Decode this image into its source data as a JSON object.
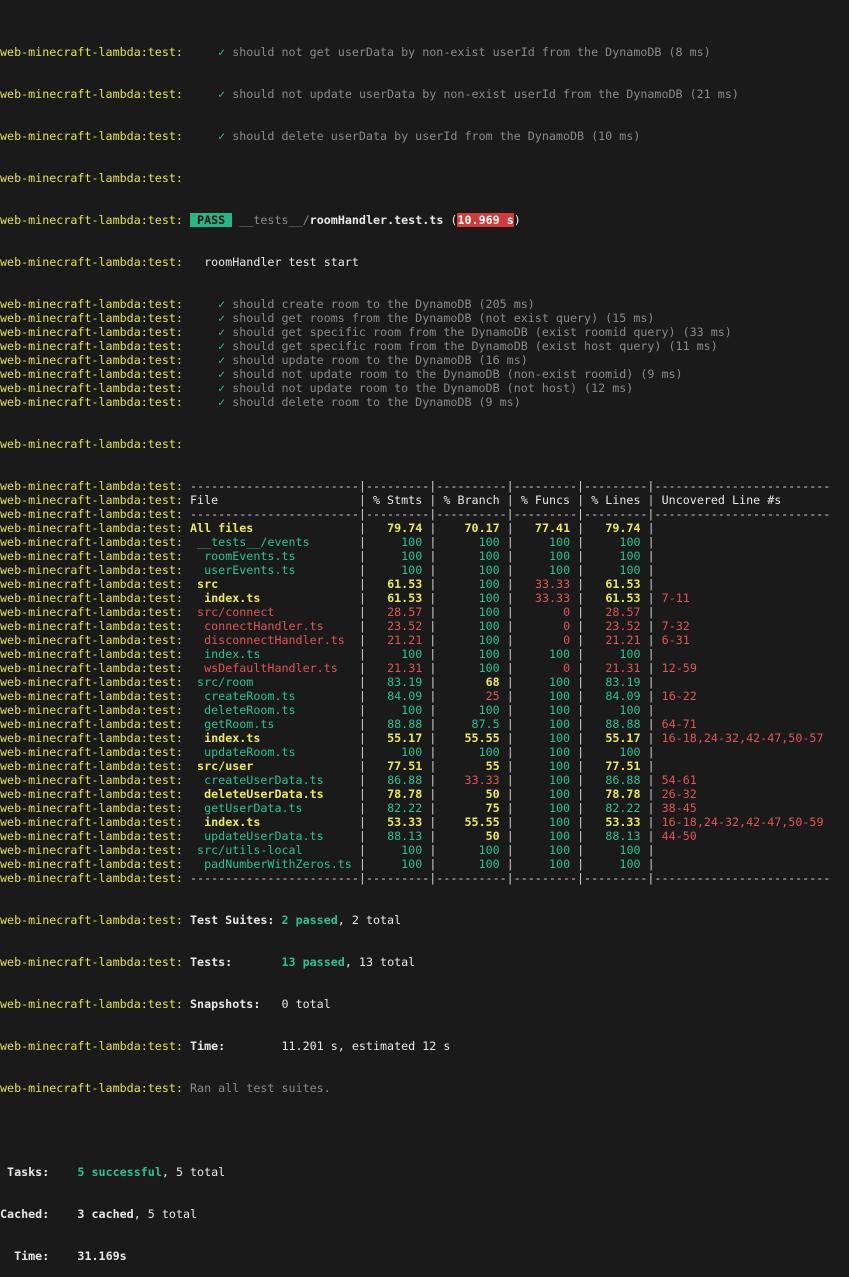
{
  "prefix": "web-minecraft-lambda:test:",
  "userDataTests": [
    "should not get userData by non-exist userId from the DynamoDB (8 ms)",
    "should not update userData by non-exist userId from the DynamoDB (21 ms)",
    "should delete userData by userId from the DynamoDB (10 ms)"
  ],
  "suite": {
    "status": "PASS",
    "path_dir": "__tests__/",
    "path_file": "roomHandler.test.ts",
    "duration": "10.969 s",
    "describe": "roomHandler test start",
    "check_glyph": "✓",
    "tests": [
      "should create room to the DynamoDB (205 ms)",
      "should get rooms from the DynamoDB (not exist query) (15 ms)",
      "should get specific room from the DynamoDB (exist roomid query) (33 ms)",
      "should get specific room from the DynamoDB (exist host query) (11 ms)",
      "should update room to the DynamoDB (16 ms)",
      "should not update room to the DynamoDB (non-exist roomid) (9 ms)",
      "should not update room to the DynamoDB (not host) (12 ms)",
      "should delete room to the DynamoDB (9 ms)"
    ]
  },
  "coverage": {
    "headers": [
      "File",
      "% Stmts",
      "% Branch",
      "% Funcs",
      "% Lines",
      "Uncovered Line #s"
    ],
    "rows": [
      {
        "file": "All files",
        "indent": 0,
        "color": "yellow",
        "stmts": "79.74",
        "stmts_c": "yellow",
        "branch": "70.17",
        "branch_c": "yellow",
        "funcs": "77.41",
        "funcs_c": "yellow",
        "lines": "79.74",
        "lines_c": "yellow",
        "uncovered": ""
      },
      {
        "file": "__tests__/events",
        "indent": 1,
        "color": "green",
        "stmts": "100",
        "stmts_c": "green",
        "branch": "100",
        "branch_c": "green",
        "funcs": "100",
        "funcs_c": "green",
        "lines": "100",
        "lines_c": "green",
        "uncovered": ""
      },
      {
        "file": "roomEvents.ts",
        "indent": 2,
        "color": "green",
        "stmts": "100",
        "stmts_c": "green",
        "branch": "100",
        "branch_c": "green",
        "funcs": "100",
        "funcs_c": "green",
        "lines": "100",
        "lines_c": "green",
        "uncovered": ""
      },
      {
        "file": "userEvents.ts",
        "indent": 2,
        "color": "green",
        "stmts": "100",
        "stmts_c": "green",
        "branch": "100",
        "branch_c": "green",
        "funcs": "100",
        "funcs_c": "green",
        "lines": "100",
        "lines_c": "green",
        "uncovered": ""
      },
      {
        "file": "src",
        "indent": 1,
        "color": "yellow",
        "stmts": "61.53",
        "stmts_c": "yellow",
        "branch": "100",
        "branch_c": "green",
        "funcs": "33.33",
        "funcs_c": "red",
        "lines": "61.53",
        "lines_c": "yellow",
        "uncovered": ""
      },
      {
        "file": "index.ts",
        "indent": 2,
        "color": "yellow",
        "stmts": "61.53",
        "stmts_c": "yellow",
        "branch": "100",
        "branch_c": "green",
        "funcs": "33.33",
        "funcs_c": "red",
        "lines": "61.53",
        "lines_c": "yellow",
        "uncovered": "7-11"
      },
      {
        "file": "src/connect",
        "indent": 1,
        "color": "red",
        "stmts": "28.57",
        "stmts_c": "red",
        "branch": "100",
        "branch_c": "green",
        "funcs": "0",
        "funcs_c": "red",
        "lines": "28.57",
        "lines_c": "red",
        "uncovered": ""
      },
      {
        "file": "connectHandler.ts",
        "indent": 2,
        "color": "red",
        "stmts": "23.52",
        "stmts_c": "red",
        "branch": "100",
        "branch_c": "green",
        "funcs": "0",
        "funcs_c": "red",
        "lines": "23.52",
        "lines_c": "red",
        "uncovered": "7-32"
      },
      {
        "file": "disconnectHandler.ts",
        "indent": 2,
        "color": "red",
        "stmts": "21.21",
        "stmts_c": "red",
        "branch": "100",
        "branch_c": "green",
        "funcs": "0",
        "funcs_c": "red",
        "lines": "21.21",
        "lines_c": "red",
        "uncovered": "6-31"
      },
      {
        "file": "index.ts",
        "indent": 2,
        "color": "green",
        "stmts": "100",
        "stmts_c": "green",
        "branch": "100",
        "branch_c": "green",
        "funcs": "100",
        "funcs_c": "green",
        "lines": "100",
        "lines_c": "green",
        "uncovered": ""
      },
      {
        "file": "wsDefaultHandler.ts",
        "indent": 2,
        "color": "red",
        "stmts": "21.31",
        "stmts_c": "red",
        "branch": "100",
        "branch_c": "green",
        "funcs": "0",
        "funcs_c": "red",
        "lines": "21.31",
        "lines_c": "red",
        "uncovered": "12-59"
      },
      {
        "file": "src/room",
        "indent": 1,
        "color": "green",
        "stmts": "83.19",
        "stmts_c": "green",
        "branch": "68",
        "branch_c": "yellow",
        "funcs": "100",
        "funcs_c": "green",
        "lines": "83.19",
        "lines_c": "green",
        "uncovered": ""
      },
      {
        "file": "createRoom.ts",
        "indent": 2,
        "color": "green",
        "stmts": "84.09",
        "stmts_c": "green",
        "branch": "25",
        "branch_c": "red",
        "funcs": "100",
        "funcs_c": "green",
        "lines": "84.09",
        "lines_c": "green",
        "uncovered": "16-22"
      },
      {
        "file": "deleteRoom.ts",
        "indent": 2,
        "color": "green",
        "stmts": "100",
        "stmts_c": "green",
        "branch": "100",
        "branch_c": "green",
        "funcs": "100",
        "funcs_c": "green",
        "lines": "100",
        "lines_c": "green",
        "uncovered": ""
      },
      {
        "file": "getRoom.ts",
        "indent": 2,
        "color": "green",
        "stmts": "88.88",
        "stmts_c": "green",
        "branch": "87.5",
        "branch_c": "green",
        "funcs": "100",
        "funcs_c": "green",
        "lines": "88.88",
        "lines_c": "green",
        "uncovered": "64-71"
      },
      {
        "file": "index.ts",
        "indent": 2,
        "color": "yellow",
        "stmts": "55.17",
        "stmts_c": "yellow",
        "branch": "55.55",
        "branch_c": "yellow",
        "funcs": "100",
        "funcs_c": "green",
        "lines": "55.17",
        "lines_c": "yellow",
        "uncovered": "16-18,24-32,42-47,50-57"
      },
      {
        "file": "updateRoom.ts",
        "indent": 2,
        "color": "green",
        "stmts": "100",
        "stmts_c": "green",
        "branch": "100",
        "branch_c": "green",
        "funcs": "100",
        "funcs_c": "green",
        "lines": "100",
        "lines_c": "green",
        "uncovered": ""
      },
      {
        "file": "src/user",
        "indent": 1,
        "color": "yellow",
        "stmts": "77.51",
        "stmts_c": "yellow",
        "branch": "55",
        "branch_c": "yellow",
        "funcs": "100",
        "funcs_c": "green",
        "lines": "77.51",
        "lines_c": "yellow",
        "uncovered": ""
      },
      {
        "file": "createUserData.ts",
        "indent": 2,
        "color": "green",
        "stmts": "86.88",
        "stmts_c": "green",
        "branch": "33.33",
        "branch_c": "red",
        "funcs": "100",
        "funcs_c": "green",
        "lines": "86.88",
        "lines_c": "green",
        "uncovered": "54-61"
      },
      {
        "file": "deleteUserData.ts",
        "indent": 2,
        "color": "yellow",
        "stmts": "78.78",
        "stmts_c": "yellow",
        "branch": "50",
        "branch_c": "yellow",
        "funcs": "100",
        "funcs_c": "green",
        "lines": "78.78",
        "lines_c": "yellow",
        "uncovered": "26-32"
      },
      {
        "file": "getUserData.ts",
        "indent": 2,
        "color": "green",
        "stmts": "82.22",
        "stmts_c": "green",
        "branch": "75",
        "branch_c": "yellow",
        "funcs": "100",
        "funcs_c": "green",
        "lines": "82.22",
        "lines_c": "green",
        "uncovered": "38-45"
      },
      {
        "file": "index.ts",
        "indent": 2,
        "color": "yellow",
        "stmts": "53.33",
        "stmts_c": "yellow",
        "branch": "55.55",
        "branch_c": "yellow",
        "funcs": "100",
        "funcs_c": "green",
        "lines": "53.33",
        "lines_c": "yellow",
        "uncovered": "16-18,24-32,42-47,50-59"
      },
      {
        "file": "updateUserData.ts",
        "indent": 2,
        "color": "green",
        "stmts": "88.13",
        "stmts_c": "green",
        "branch": "50",
        "branch_c": "yellow",
        "funcs": "100",
        "funcs_c": "green",
        "lines": "88.13",
        "lines_c": "green",
        "uncovered": "44-50"
      },
      {
        "file": "src/utils-local",
        "indent": 1,
        "color": "green",
        "stmts": "100",
        "stmts_c": "green",
        "branch": "100",
        "branch_c": "green",
        "funcs": "100",
        "funcs_c": "green",
        "lines": "100",
        "lines_c": "green",
        "uncovered": ""
      },
      {
        "file": "padNumberWithZeros.ts",
        "indent": 2,
        "color": "green",
        "stmts": "100",
        "stmts_c": "green",
        "branch": "100",
        "branch_c": "green",
        "funcs": "100",
        "funcs_c": "green",
        "lines": "100",
        "lines_c": "green",
        "uncovered": ""
      }
    ]
  },
  "summary": {
    "suites_label": "Test Suites:",
    "suites_passed": "2 passed",
    "suites_total": ", 2 total",
    "tests_label": "Tests:",
    "tests_passed": "13 passed",
    "tests_total": ", 13 total",
    "snapshots_label": "Snapshots:",
    "snapshots_value": "0 total",
    "time_label": "Time:",
    "time_value": "11.201 s, estimated 12 s",
    "ran_all": "Ran all test suites."
  },
  "turbo": {
    "tasks_label": " Tasks:",
    "tasks_success": "5 successful",
    "tasks_total": ", 5 total",
    "cached_label": "Cached:",
    "cached_value": "3 cached",
    "cached_total": ", 5 total",
    "time_label": "  Time:",
    "time_value": "31.169s"
  },
  "colors": {
    "background": "#1a1a1a",
    "prefix": "#e3e34d",
    "pass_badge": "#27b784",
    "time_badge": "#d53a3a",
    "green": "#29c48e",
    "yellow": "#eaea5a",
    "red": "#e05555"
  }
}
